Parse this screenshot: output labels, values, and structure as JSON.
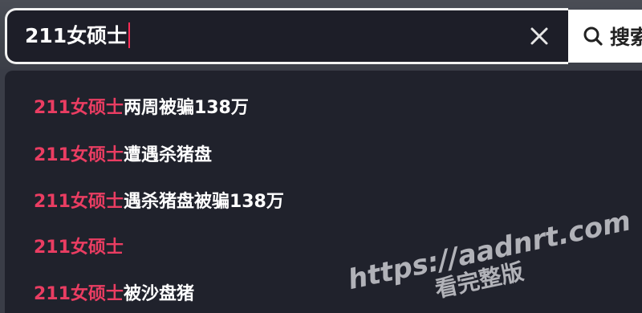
{
  "search": {
    "query": "211女硕士",
    "button_label": "搜索"
  },
  "suggestions": [
    {
      "highlight": "211女硕士",
      "rest": "两周被骗138万"
    },
    {
      "highlight": "211女硕士",
      "rest": "遭遇杀猪盘"
    },
    {
      "highlight": "211女硕士",
      "rest": "遇杀猪盘被骗138万"
    },
    {
      "highlight": "211女硕士",
      "rest": ""
    },
    {
      "highlight": "211女硕士",
      "rest": "被沙盘猪"
    }
  ],
  "watermark": {
    "url": "https://aadnrt.com",
    "subtitle": "看完整版"
  },
  "colors": {
    "highlight": "#ea3d62",
    "caret": "#fe2c55",
    "dropdown_bg": "#20222c"
  },
  "icons": {
    "clear": "close-icon",
    "search": "search-icon"
  }
}
